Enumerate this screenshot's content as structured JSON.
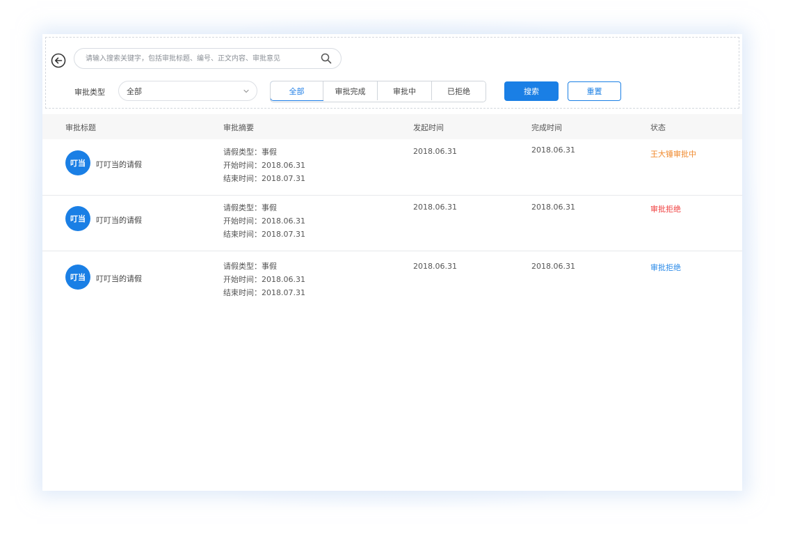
{
  "search": {
    "placeholder": "请输入搜索关键字，包括审批标题、编号、正文内容、审批意见"
  },
  "filter": {
    "type_label": "审批类型",
    "type_value": "全部",
    "segments": [
      "全部",
      "审批完成",
      "审批中",
      "已拒绝"
    ],
    "active_segment": 0,
    "search_button": "搜索",
    "reset_button": "重置"
  },
  "table": {
    "headers": [
      "审批标题",
      "审批摘要",
      "发起时间",
      "完成时间",
      "状态"
    ],
    "rows": [
      {
        "avatar": "叮当",
        "title": "叮叮当的请假",
        "summary": [
          "请假类型：事假",
          "开始时间：2018.06.31",
          "结束时间：2018.07.31"
        ],
        "start": "2018.06.31",
        "end": "2018.06.31",
        "status": "王大锤审批中",
        "status_color": "#f08a2e"
      },
      {
        "avatar": "叮当",
        "title": "叮叮当的请假",
        "summary": [
          "请假类型：事假",
          "开始时间：2018.06.31",
          "结束时间：2018.07.31"
        ],
        "start": "2018.06.31",
        "end": "2018.06.31",
        "status": "审批拒绝",
        "status_color": "#f04040"
      },
      {
        "avatar": "叮当",
        "title": "叮叮当的请假",
        "summary": [
          "请假类型：事假",
          "开始时间：2018.06.31",
          "结束时间：2018.07.31"
        ],
        "start": "2018.06.31",
        "end": "2018.06.31",
        "status": "审批拒绝",
        "status_color": "#2a8ae8"
      }
    ]
  },
  "colors": {
    "accent": "#1a7fe5"
  },
  "icons": {
    "back": "arrow-left-circle-icon",
    "search": "search-icon",
    "select": "chevron-down-icon"
  }
}
